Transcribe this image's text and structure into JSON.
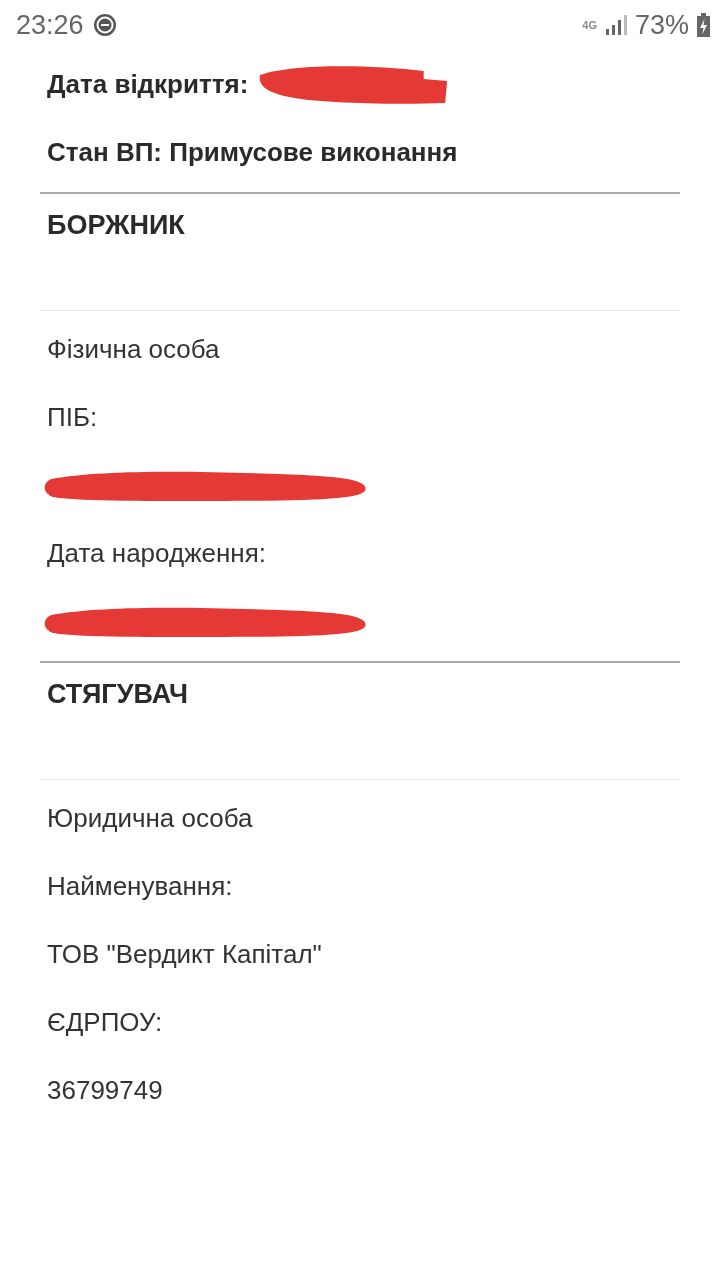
{
  "status_bar": {
    "time": "23:26",
    "network": "4G",
    "battery": "73%"
  },
  "case": [
    {
      "label": "Дата відкриття:",
      "redacted": true
    },
    {
      "label": "Стан ВП:",
      "value": "Примусове виконання",
      "redacted": false
    }
  ],
  "parties": [
    {
      "heading": "БОРЖНИК",
      "lines": [
        {
          "kind": "text",
          "text": "Фізична особа"
        },
        {
          "kind": "text",
          "text": "ПІБ:"
        },
        {
          "kind": "redacted"
        },
        {
          "kind": "text",
          "text": "Дата народження:"
        },
        {
          "kind": "redacted"
        }
      ]
    },
    {
      "heading": "СТЯГУВАЧ",
      "lines": [
        {
          "kind": "text",
          "text": "Юридична особа"
        },
        {
          "kind": "text",
          "text": "Найменування:"
        },
        {
          "kind": "text",
          "text": "ТОВ \"Вердикт Капітал\""
        },
        {
          "kind": "text",
          "text": "ЄДРПОУ:"
        },
        {
          "kind": "text",
          "text": "36799749"
        }
      ]
    }
  ]
}
